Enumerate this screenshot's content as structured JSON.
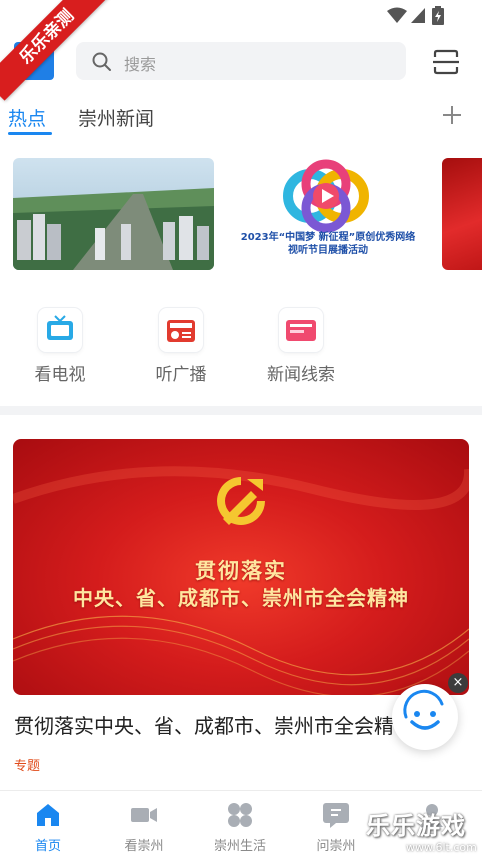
{
  "watermark_ribbon": "乐乐亲测",
  "search": {
    "placeholder": "搜索"
  },
  "tabs": [
    {
      "label": "热点",
      "active": true
    },
    {
      "label": "崇州新闻",
      "active": false
    }
  ],
  "carousel": {
    "card2_caption": "2023年“中国梦 新征程”原创优秀网络视听节目展播活动"
  },
  "quick_menu": [
    {
      "label": "看电视",
      "icon": "tv-icon"
    },
    {
      "label": "听广播",
      "icon": "radio-icon"
    },
    {
      "label": "新闻线索",
      "icon": "news-clue-icon"
    }
  ],
  "feature": {
    "banner_line1": "贯彻落实",
    "banner_line2": "中央、省、成都市、崇州市全会精神",
    "headline": "贯彻落实中央、省、成都市、崇州市全会精神",
    "tag": "专题"
  },
  "bottom_nav": [
    {
      "label": "首页",
      "icon": "home-icon",
      "active": true
    },
    {
      "label": "看崇州",
      "icon": "video-icon",
      "active": false
    },
    {
      "label": "崇州生活",
      "icon": "grid-icon",
      "active": false
    },
    {
      "label": "问崇州",
      "icon": "ask-icon",
      "active": false
    }
  ],
  "corner_watermark": {
    "big": "乐乐游戏",
    "small": "www.6lt.com"
  },
  "colors": {
    "accent": "#1a87f0",
    "banner_red": "#d41c1c",
    "tag": "#e04b1a"
  }
}
